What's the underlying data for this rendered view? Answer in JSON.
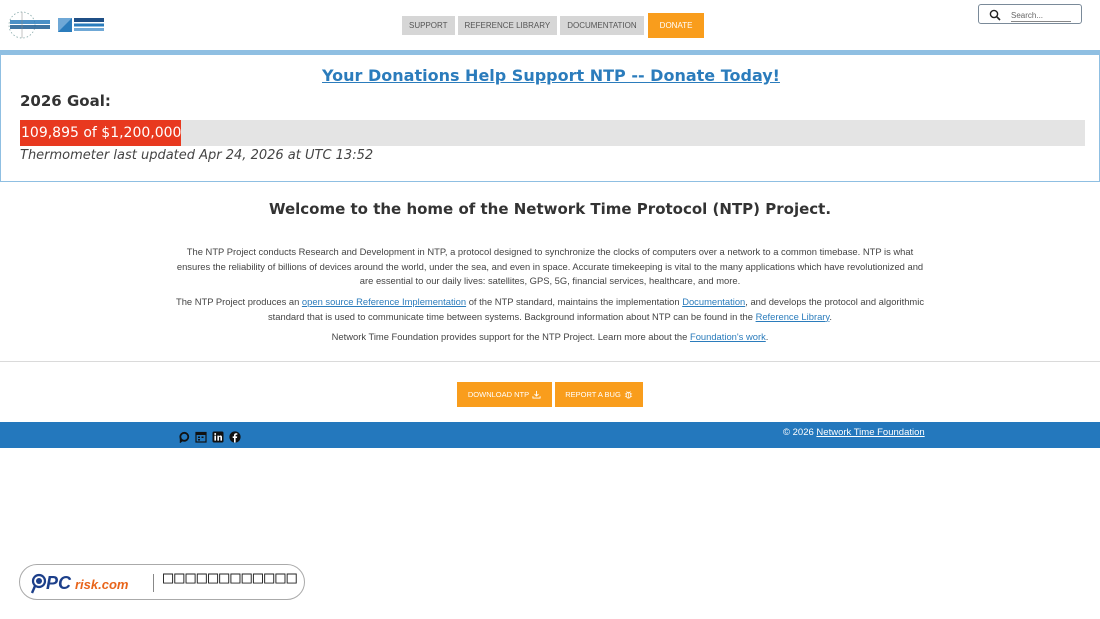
{
  "header": {
    "nav": [
      {
        "label": "SUPPORT"
      },
      {
        "label": "REFERENCE LIBRARY"
      },
      {
        "label": "DOCUMENTATION"
      },
      {
        "label": "DONATE"
      }
    ],
    "search_placeholder": "Search..."
  },
  "donation": {
    "title": "Your Donations Help Support NTP -- Donate Today!",
    "goal_label": "2026 Goal:",
    "progress_text": "109,895 of $1,200,000",
    "raised": 109895,
    "goal": 1200000,
    "updated": "Thermometer last updated Apr 24, 2026 at UTC 13:52"
  },
  "main": {
    "welcome": "Welcome to the home of the Network Time Protocol (NTP) Project.",
    "p1": "The NTP Project conducts Research and Development in NTP, a protocol designed to synchronize the clocks of computers over a network to a common timebase. NTP is what ensures the reliability of billions of devices around the world, under the sea, and even in space. Accurate timekeeping is vital to the many applications which have revolutionized and are essential to our daily lives: satellites, GPS, 5G, financial services, healthcare, and more.",
    "p2_a": "The NTP Project produces an ",
    "p2_link1": "open source Reference Implementation",
    "p2_b": " of the NTP standard, maintains the implementation ",
    "p2_link2": "Documentation",
    "p2_c": ", and develops the protocol and algorithmic standard that is used to communicate time between systems. Background information about NTP can be found in the ",
    "p2_link3": "Reference Library",
    "p2_d": ".",
    "p3_a": "Network Time Foundation provides support for the NTP Project. Learn more about the ",
    "p3_link": "Foundation's work",
    "p3_b": "."
  },
  "actions": {
    "download_label": "DOWNLOAD NTP",
    "bug_label": "REPORT A BUG"
  },
  "footer": {
    "copyright_prefix": "© 2026 ",
    "copyright_link": "Network Time Foundation"
  },
  "badge": {
    "tagline": "□□□□□□□□□□□□"
  },
  "colors": {
    "accent_orange": "#f99d1c",
    "link_blue": "#2b7cbc",
    "footer_blue": "#2478bd",
    "thermo_red": "#e8391f"
  }
}
